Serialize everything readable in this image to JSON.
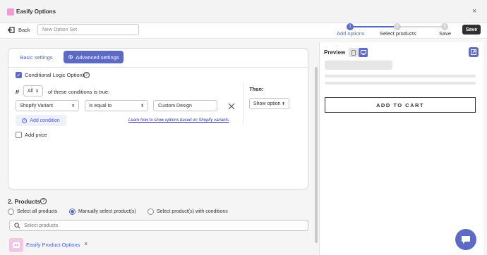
{
  "window": {
    "title": "Easify Options",
    "close_glyph": "×"
  },
  "toolbar": {
    "back_label": "Back",
    "name_placeholder": "New Option Set",
    "save_label": "Save",
    "steps": [
      {
        "num": "1",
        "label": "Add options",
        "active": true
      },
      {
        "num": "2",
        "label": "Select products",
        "active": false
      },
      {
        "num": "3",
        "label": "Save",
        "active": false
      }
    ]
  },
  "tabs": {
    "basic": "Basic settings",
    "advanced": "Advanced settings"
  },
  "logic": {
    "checkbox_label": "Conditional Logic Options",
    "help_glyph": "?",
    "if_label": "If",
    "match_value": "All",
    "conditions_text": "of these conditions is true:",
    "then_label": "Then:",
    "condition": {
      "field": "Shopify Variant",
      "operator": "Is equal to",
      "value": "Custom Design"
    },
    "action_value": "Show option",
    "add_condition_label": "Add condition",
    "learn_link": "Learn how to show options based on Shopify variants",
    "add_price_label": "Add price"
  },
  "products": {
    "heading": "2. Products",
    "options": [
      "Select all products",
      "Manually select product(s)",
      "Select product(s) with conditions"
    ],
    "selected_index": 1,
    "search_placeholder": "Select products",
    "items": [
      {
        "name": "Easify Product Options",
        "remove_glyph": "×"
      }
    ]
  },
  "preview": {
    "title": "Preview",
    "add_to_cart": "ADD TO CART"
  },
  "colors": {
    "accent": "#5c6ac4",
    "dark": "#303030",
    "link": "#2c2ca8"
  },
  "icons": [
    "app-logo-icon",
    "back-arrow-icon",
    "gear-icon",
    "help-icon",
    "close-icon",
    "search-icon",
    "mobile-icon",
    "desktop-icon",
    "expand-icon",
    "chat-icon",
    "product-thumb-icon"
  ]
}
